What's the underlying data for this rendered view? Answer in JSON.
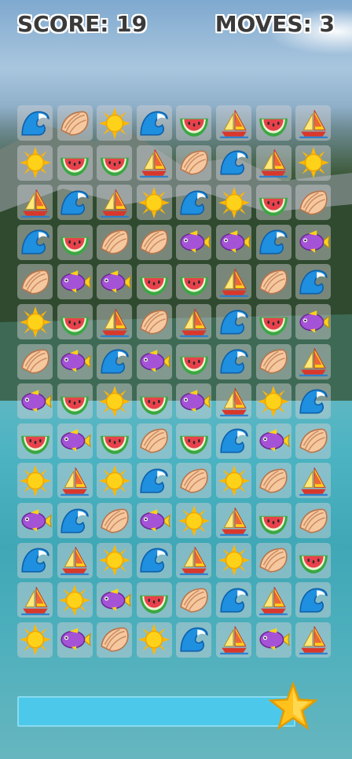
{
  "hud": {
    "score_text": "SCORE: 19",
    "moves_text": "MOVES: 3"
  },
  "board": {
    "rows": 14,
    "cols": 8,
    "grid": [
      [
        "wave",
        "shell",
        "sun",
        "wave",
        "watermelon",
        "sailboat",
        "watermelon",
        "sailboat"
      ],
      [
        "sun",
        "watermelon",
        "watermelon",
        "sailboat",
        "shell",
        "wave",
        "sailboat",
        "sun"
      ],
      [
        "sailboat",
        "wave",
        "sailboat",
        "sun",
        "wave",
        "sun",
        "watermelon",
        "shell"
      ],
      [
        "wave",
        "watermelon",
        "shell",
        "shell",
        "fish",
        "fish",
        "wave",
        "fish"
      ],
      [
        "shell",
        "fish",
        "fish",
        "watermelon",
        "watermelon",
        "sailboat",
        "shell",
        "wave"
      ],
      [
        "sun",
        "watermelon",
        "sailboat",
        "shell",
        "sailboat",
        "wave",
        "watermelon",
        "fish"
      ],
      [
        "shell",
        "fish",
        "wave",
        "fish",
        "watermelon",
        "wave",
        "shell",
        "sailboat"
      ],
      [
        "fish",
        "watermelon",
        "sun",
        "watermelon",
        "fish",
        "sailboat",
        "sun",
        "wave"
      ],
      [
        "watermelon",
        "fish",
        "watermelon",
        "shell",
        "watermelon",
        "wave",
        "fish",
        "shell"
      ],
      [
        "sun",
        "sailboat",
        "sun",
        "wave",
        "shell",
        "sun",
        "shell",
        "sailboat"
      ],
      [
        "fish",
        "wave",
        "shell",
        "fish",
        "sun",
        "sailboat",
        "watermelon",
        "shell"
      ],
      [
        "wave",
        "sailboat",
        "sun",
        "wave",
        "sailboat",
        "sun",
        "shell",
        "watermelon"
      ],
      [
        "sailboat",
        "sun",
        "fish",
        "watermelon",
        "shell",
        "wave",
        "sailboat",
        "wave"
      ],
      [
        "sun",
        "fish",
        "shell",
        "sun",
        "wave",
        "sailboat",
        "fish",
        "sailboat"
      ]
    ]
  },
  "progress": {
    "fraction": 1.0,
    "icon": "star-icon"
  },
  "colors": {
    "progress": "#4cc9ea",
    "star": "#ffc21c",
    "hud_text": "#3a3a3a"
  }
}
